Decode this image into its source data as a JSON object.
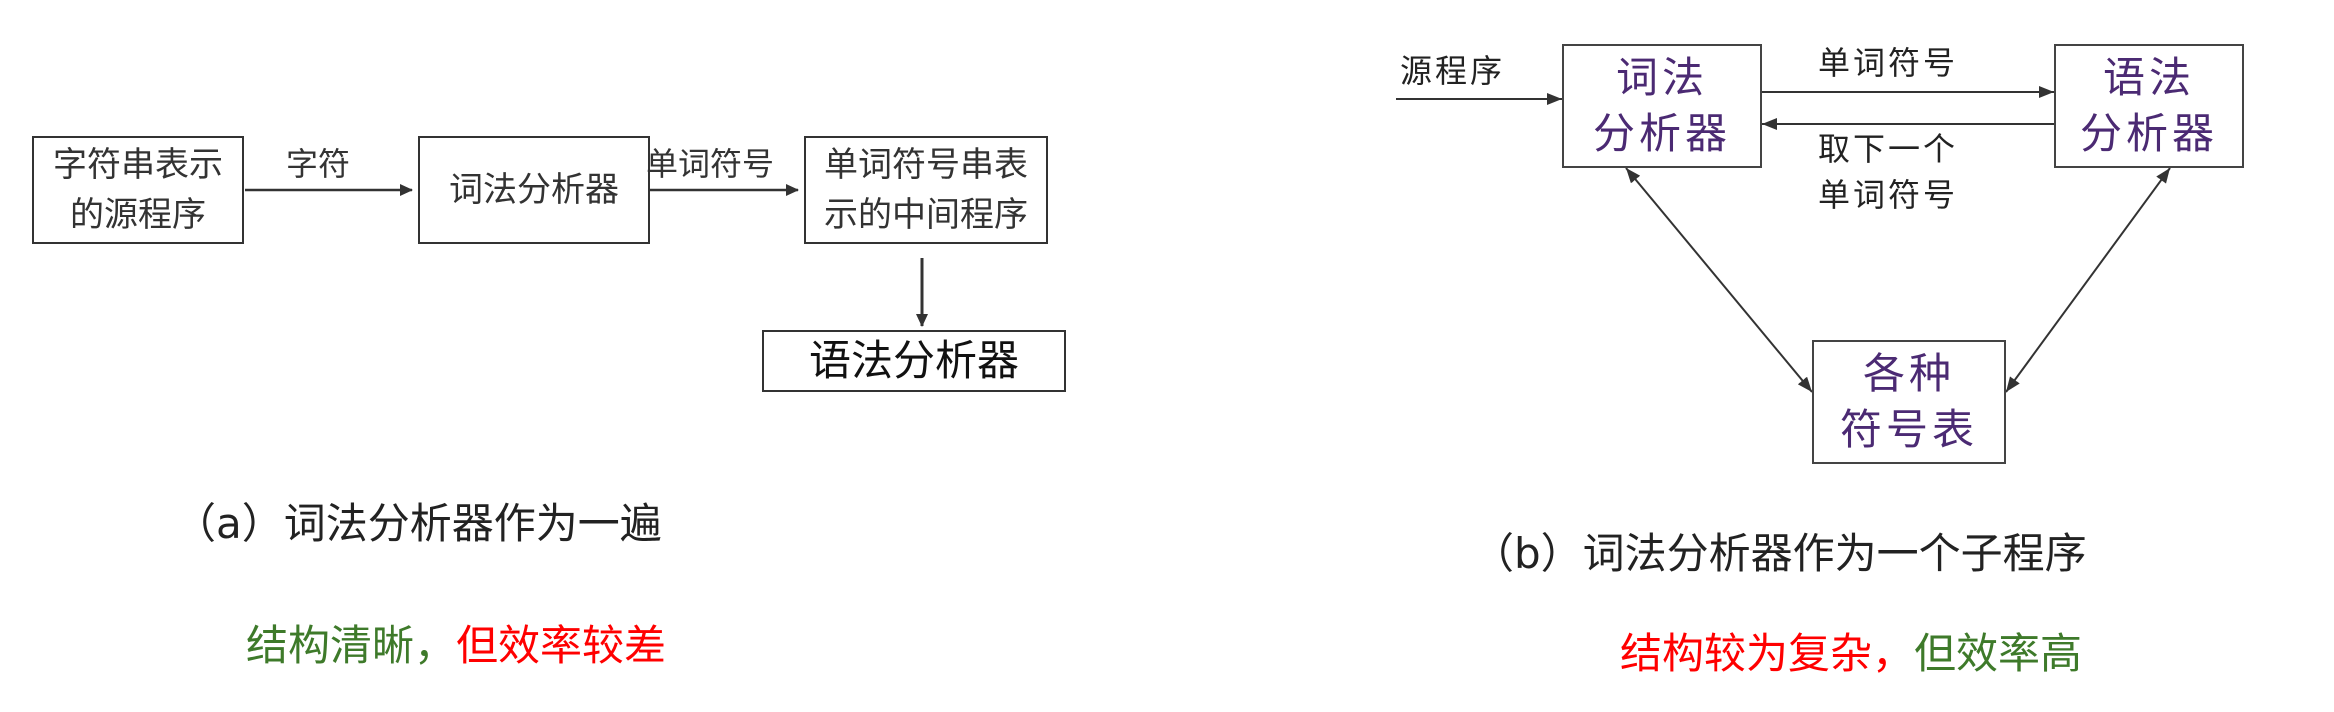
{
  "colors": {
    "line": "#333333",
    "box_text_b": "#4b2a73",
    "green": "#3e7a2a",
    "red": "#ff0000"
  },
  "diagram_a": {
    "nodes": {
      "source": "字符串表示\n的源程序",
      "lexer": "词法分析器",
      "intermediate": "单词符号串表\n示的中间程序",
      "parser": "语法分析器"
    },
    "edges": {
      "chars": "字符",
      "tokens": "单词符号"
    },
    "caption": "（a）词法分析器作为一遍",
    "note": {
      "good": "结构清晰，",
      "bad": "但效率较差"
    }
  },
  "diagram_b": {
    "nodes": {
      "lexer": "词法\n分析器",
      "parser": "语法\n分析器",
      "tables": "各种\n符号表"
    },
    "edges": {
      "source": "源程序",
      "token": "单词符号",
      "next_token": "取下一个\n单词符号"
    },
    "caption": "（b）词法分析器作为一个子程序",
    "note": {
      "bad": "结构较为复杂，",
      "good": "但效率高"
    }
  }
}
